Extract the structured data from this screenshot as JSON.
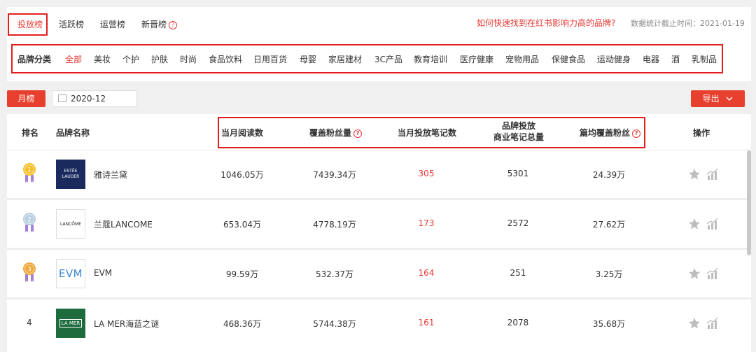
{
  "tabs": [
    {
      "label": "投放榜",
      "active": true
    },
    {
      "label": "活跃榜",
      "active": false
    },
    {
      "label": "运营榜",
      "active": false
    },
    {
      "label": "新晋榜",
      "active": false
    }
  ],
  "promo_link": "如何快速找到在红书影响力高的品牌?",
  "stat_time": "数据统计截止时间：2021-01-19",
  "category": {
    "label": "品牌分类",
    "items": [
      "全部",
      "美妆",
      "个护",
      "护肤",
      "时尚",
      "食品饮料",
      "日用百货",
      "母婴",
      "家居建材",
      "3C产品",
      "教育培训",
      "医疗健康",
      "宠物用品",
      "保健食品",
      "运动健身",
      "电器",
      "酒",
      "乳制品"
    ],
    "active": "全部"
  },
  "filter": {
    "period_button": "月榜",
    "date_value": "2020-12",
    "export_button": "导出"
  },
  "table": {
    "headers": {
      "rank": "排名",
      "brand": "品牌名称",
      "monthly_reads": "当月阅读数",
      "covered_fans": "覆盖粉丝量",
      "notes_this_month": "当月投放笔记数",
      "total_notes_line1": "品牌投放",
      "total_notes_line2": "商业笔记总量",
      "avg_fans": "篇均覆盖粉丝",
      "action": "操作"
    },
    "rows": [
      {
        "rank": "1",
        "brand": "雅诗兰黛",
        "logo_text": "ESTĒE LAUDER",
        "reads": "1046.05万",
        "fans": "7439.34万",
        "notes": "305",
        "total": "5301",
        "avg": "24.39万"
      },
      {
        "rank": "2",
        "brand": "兰蔻LANCOME",
        "logo_text": "LANCÔME",
        "reads": "653.04万",
        "fans": "4778.19万",
        "notes": "173",
        "total": "2572",
        "avg": "27.62万"
      },
      {
        "rank": "3",
        "brand": "EVM",
        "logo_text": "EVM",
        "reads": "99.59万",
        "fans": "532.37万",
        "notes": "164",
        "total": "251",
        "avg": "3.25万"
      },
      {
        "rank": "4",
        "brand": "LA MER海蓝之谜",
        "logo_text": "LA MER",
        "reads": "468.36万",
        "fans": "5744.38万",
        "notes": "161",
        "total": "2078",
        "avg": "35.68万"
      }
    ]
  },
  "icons": {
    "help": "question-circle-icon",
    "calendar": "calendar-icon",
    "chevron": "chevron-down-icon",
    "star": "star-icon",
    "trend": "bar-chart-icon"
  },
  "colors": {
    "accent": "#e53935",
    "button": "#e8402f",
    "highlight_box": "#e02020",
    "logo_estee": "#1a2a5c",
    "logo_lamer": "#1e6b3e",
    "medal_gold": "#f5c02a",
    "medal_silver": "#b8cde0",
    "medal_bronze": "#f0a63a"
  }
}
